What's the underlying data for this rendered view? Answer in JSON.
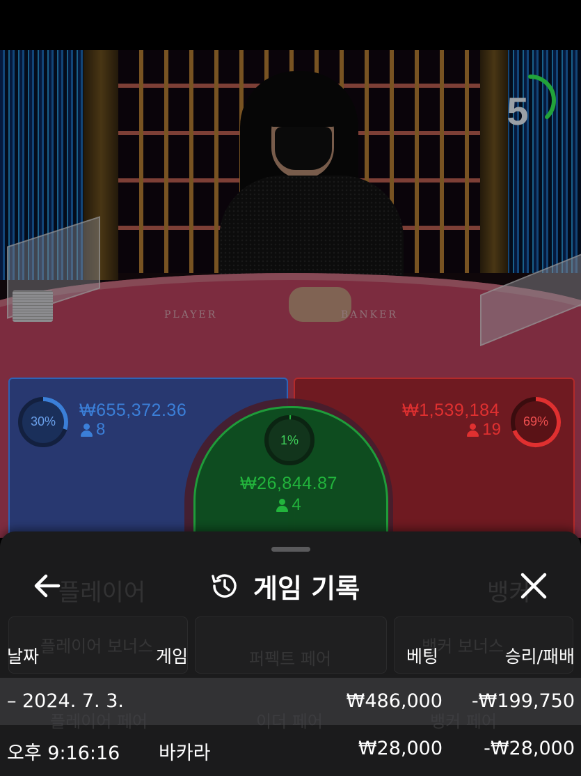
{
  "timer": {
    "value": "5",
    "color": "#22a33a"
  },
  "bets": {
    "player": {
      "percent": "30%",
      "percent_value": 30,
      "amount": "₩655,372.36",
      "count": "8",
      "color": "#3b7fd8"
    },
    "banker": {
      "percent": "69%",
      "percent_value": 69,
      "amount": "₩1,539,184",
      "count": "19",
      "color": "#e03030"
    },
    "tie": {
      "percent": "1%",
      "percent_value": 1,
      "amount": "₩26,844.87",
      "count": "4",
      "color": "#22b43c"
    }
  },
  "table_labels": {
    "player": "PLAYER",
    "banker": "BANKER"
  },
  "sheet": {
    "title": "게임 기록",
    "back_icon": "arrow-left-icon",
    "history_icon": "history-icon",
    "close_icon": "close-icon",
    "columns": {
      "date": "날짜",
      "game": "게임",
      "bet": "베팅",
      "winloss": "승리/패배"
    },
    "date_row": {
      "date": "2024. 7. 3.",
      "bet": "₩486,000",
      "winloss": "-₩199,750"
    },
    "rows": [
      {
        "time": "오후 9:16:16",
        "game": "바카라",
        "bet": "₩28,000",
        "winloss": "-₩28,000"
      }
    ]
  },
  "background_ghost": {
    "player_title": "플레이어",
    "banker_title": "뱅커",
    "player_bonus": "플레이어 보너스",
    "perfect_pair": "퍼펙트 페어",
    "banker_bonus": "뱅커 보너스",
    "player_pair": "플레이어 페어",
    "either_pair": "이더 페어",
    "banker_pair": "뱅커 페어"
  }
}
